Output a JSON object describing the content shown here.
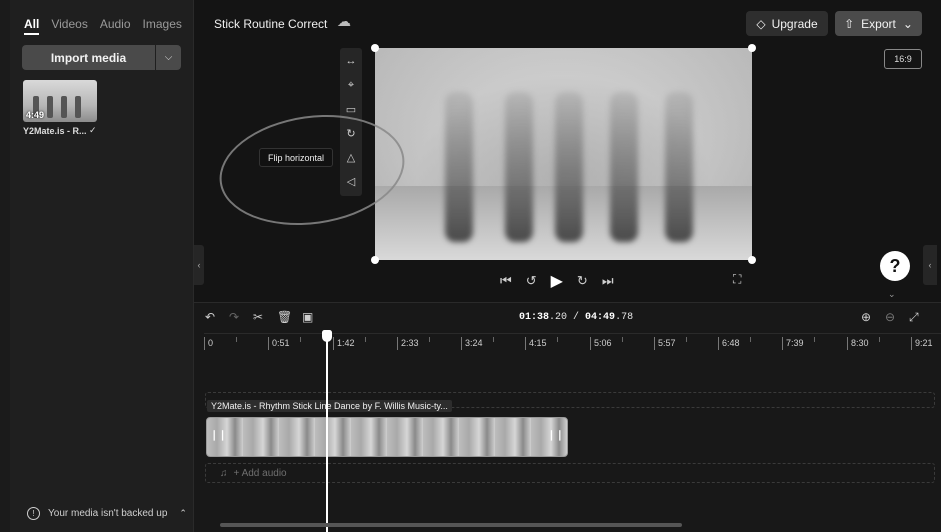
{
  "media_panel": {
    "tabs": [
      "All",
      "Videos",
      "Audio",
      "Images"
    ],
    "import_label": "Import media",
    "thumb_duration": "4:49",
    "thumb_label": "Y2Mate.is - R...",
    "backup_text": "Your media isn't backed up"
  },
  "header": {
    "project_title": "Stick Routine Correct",
    "upgrade_label": "Upgrade",
    "export_label": "Export",
    "aspect_ratio": "16:9"
  },
  "preview": {
    "tooltip": "Flip horizontal"
  },
  "timeline": {
    "current_time": "01:38",
    "current_frac": ".20",
    "total_time": "04:49",
    "total_frac": ".78",
    "ruler": [
      "0",
      "0:51",
      "1:42",
      "2:33",
      "3:24",
      "4:15",
      "5:06",
      "5:57",
      "6:48",
      "7:39",
      "8:30",
      "9:21"
    ],
    "clip_label": "Y2Mate.is - Rhythm Stick Line Dance by F. Willis Music-ty...",
    "add_audio": "+ Add audio"
  }
}
